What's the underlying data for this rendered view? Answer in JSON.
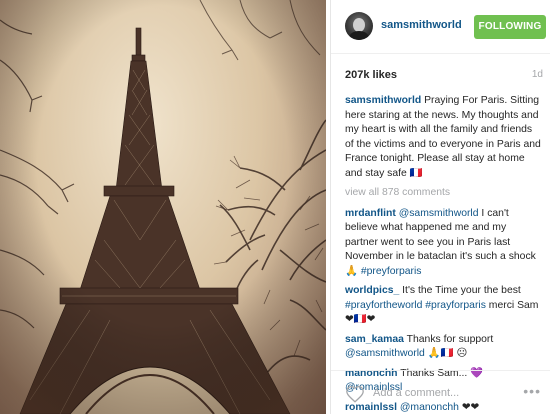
{
  "post": {
    "username": "samsmithworld",
    "follow_label": "FOLLOWING",
    "likes": "207k likes",
    "age": "1d",
    "caption": "Praying For Paris. Sitting here staring at the news. My thoughts and my heart is with all the family and friends of the victims and to everyone in Paris and France tonight. Please all stay at home and stay safe 🇫🇷",
    "view_all": "view all 878 comments",
    "add_comment_placeholder": "Add a comment...",
    "more_icon": "•••"
  },
  "comments": [
    {
      "user": "mrdanflint",
      "mention": "@samsmithworld",
      "text": " I can't believe what happened me and my partner went to see you in Paris last November in le bataclan it's such a shock 🙏 ",
      "tag": "#preyforparis"
    },
    {
      "user": "worldpics_",
      "text": " It's the Time your the best ",
      "tag": "#prayfortheworld #prayforparis",
      "text2": " merci Sam ❤🇫🇷❤"
    },
    {
      "user": "sam_kamaa",
      "text": " Thanks for support ",
      "mention": "@samsmithworld",
      "text2": " 🙏🇫🇷 ☹"
    },
    {
      "user": "manonchh",
      "text": " Thanks Sam... 💜 ",
      "mention": "@romainlssl"
    },
    {
      "user": "romainlssl",
      "mention": "@manonchh",
      "text": " ❤❤"
    }
  ],
  "colors": {
    "link": "#125688",
    "follow": "#70c050",
    "muted": "#a5a7aa"
  },
  "icons": {
    "heart": "heart-outline-icon",
    "avatar": "avatar"
  }
}
